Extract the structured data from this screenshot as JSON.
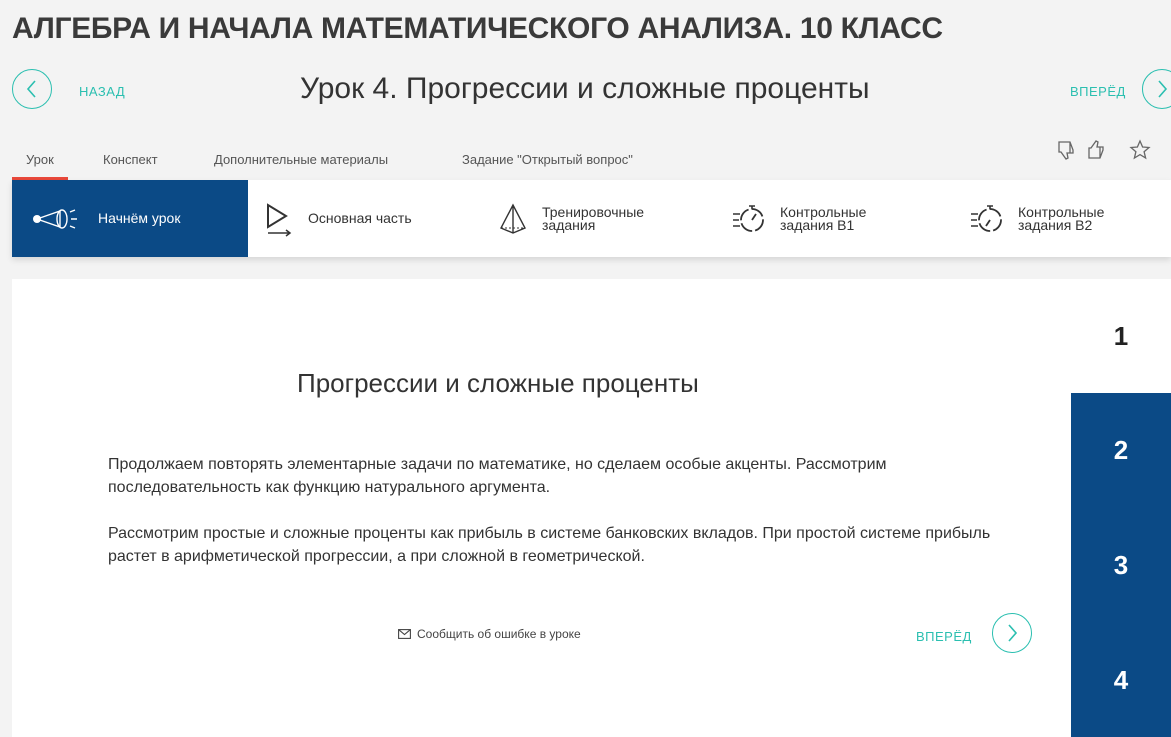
{
  "header": {
    "course_title": "АЛГЕБРА И НАЧАЛА МАТЕМАТИЧЕСКОГО АНАЛИЗА. 10 КЛАСС",
    "back_label": "НАЗАД",
    "lesson_title": "Урок 4. Прогрессии и сложные проценты",
    "forward_label": "ВПЕРЁД"
  },
  "tabs": [
    {
      "label": "Урок",
      "active": true
    },
    {
      "label": "Конспект"
    },
    {
      "label": "Дополнительные материалы"
    },
    {
      "label": "Задание \"Открытый вопрос\""
    }
  ],
  "rating_icons": [
    "thumbs-down-icon",
    "thumbs-up-icon",
    "star-icon"
  ],
  "stages": [
    {
      "label": "Начнём урок",
      "icon": "telescope-icon",
      "active": true
    },
    {
      "label": "Основная часть",
      "icon": "play-icon"
    },
    {
      "label_line1": "Тренировочные",
      "label_line2": "задания",
      "icon": "pyramid-icon"
    },
    {
      "label_line1": "Контрольные",
      "label_line2": "задания В1",
      "icon": "stopwatch-icon"
    },
    {
      "label_line1": "Контрольные",
      "label_line2": "задания В2",
      "icon": "stopwatch-icon"
    }
  ],
  "content": {
    "title": "Прогрессии и сложные проценты",
    "paragraph1": "Продолжаем повторять элементарные задачи по математике, но сделаем особые акценты. Рассмотрим последовательность как функцию натурального аргумента.",
    "paragraph2": "Рассмотрим простые и сложные проценты как прибыль в системе банковских вкладов. При простой системе прибыль растет в арифметической прогрессии, а при сложной в геометрической.",
    "report_error": "Сообщить об ошибке в уроке",
    "forward_label": "ВПЕРЁД"
  },
  "pager": [
    {
      "label": "1",
      "current": true
    },
    {
      "label": "2"
    },
    {
      "label": "3"
    },
    {
      "label": "4"
    }
  ],
  "colors": {
    "accent": "#2bbfb0",
    "primary": "#0b4a86",
    "active_tab": "#e8483a"
  }
}
